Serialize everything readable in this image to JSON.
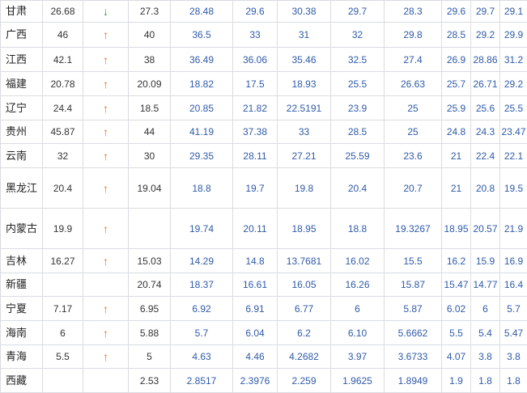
{
  "arrow_symbols": {
    "up": "↑",
    "down": "↓"
  },
  "colors": {
    "up": "#ff6a14",
    "down": "#2aa12a",
    "value": "#2f5aa8",
    "border": "#d9dce3"
  },
  "rows": [
    {
      "province": "甘肃",
      "current": "26.68",
      "trend": "down",
      "prev": "27.3",
      "values": [
        "28.48",
        "29.6",
        "30.38",
        "29.7",
        "28.3",
        "29.6",
        "29.7",
        "29.1"
      ]
    },
    {
      "province": "广西",
      "current": "46",
      "trend": "up",
      "prev": "40",
      "values": [
        "36.5",
        "33",
        "31",
        "32",
        "29.8",
        "28.5",
        "29.2",
        "29.9"
      ]
    },
    {
      "province": "江西",
      "current": "42.1",
      "trend": "up",
      "prev": "38",
      "values": [
        "36.49",
        "36.06",
        "35.46",
        "32.5",
        "27.4",
        "26.9",
        "28.86",
        "31.2"
      ]
    },
    {
      "province": "福建",
      "current": "20.78",
      "trend": "up",
      "prev": "20.09",
      "values": [
        "18.82",
        "17.5",
        "18.93",
        "25.5",
        "26.63",
        "25.7",
        "26.71",
        "29.2"
      ]
    },
    {
      "province": "辽宁",
      "current": "24.4",
      "trend": "up",
      "prev": "18.5",
      "values": [
        "20.85",
        "21.82",
        "22.5191",
        "23.9",
        "25",
        "25.9",
        "25.6",
        "25.5"
      ]
    },
    {
      "province": "贵州",
      "current": "45.87",
      "trend": "up",
      "prev": "44",
      "values": [
        "41.19",
        "37.38",
        "33",
        "28.5",
        "25",
        "24.8",
        "24.3",
        "23.47"
      ]
    },
    {
      "province": "云南",
      "current": "32",
      "trend": "up",
      "prev": "30",
      "values": [
        "29.35",
        "28.11",
        "27.21",
        "25.59",
        "23.6",
        "21",
        "22.4",
        "22.1"
      ]
    },
    {
      "province": "黑龙江",
      "current": "20.4",
      "trend": "up",
      "prev": "19.04",
      "values": [
        "18.8",
        "19.7",
        "19.8",
        "20.4",
        "20.7",
        "21",
        "20.8",
        "19.5"
      ]
    },
    {
      "province": "内蒙古",
      "current": "19.9",
      "trend": "up",
      "prev": "",
      "values": [
        "19.74",
        "20.11",
        "18.95",
        "18.8",
        "19.3267",
        "18.95",
        "20.57",
        "21.9"
      ]
    },
    {
      "province": "吉林",
      "current": "16.27",
      "trend": "up",
      "prev": "15.03",
      "values": [
        "14.29",
        "14.8",
        "13.7681",
        "16.02",
        "15.5",
        "16.2",
        "15.9",
        "16.9"
      ]
    },
    {
      "province": "新疆",
      "current": "",
      "trend": "",
      "prev": "20.74",
      "values": [
        "18.37",
        "16.61",
        "16.05",
        "16.26",
        "15.87",
        "15.47",
        "14.77",
        "16.4"
      ]
    },
    {
      "province": "宁夏",
      "current": "7.17",
      "trend": "up",
      "prev": "6.95",
      "values": [
        "6.92",
        "6.91",
        "6.77",
        "6",
        "5.87",
        "6.02",
        "6",
        "5.7"
      ]
    },
    {
      "province": "海南",
      "current": "6",
      "trend": "up",
      "prev": "5.88",
      "values": [
        "5.7",
        "6.04",
        "6.2",
        "6.10",
        "5.6662",
        "5.5",
        "5.4",
        "5.47"
      ]
    },
    {
      "province": "青海",
      "current": "5.5",
      "trend": "up",
      "prev": "5",
      "values": [
        "4.63",
        "4.46",
        "4.2682",
        "3.97",
        "3.6733",
        "4.07",
        "3.8",
        "3.8"
      ]
    },
    {
      "province": "西藏",
      "current": "",
      "trend": "",
      "prev": "2.53",
      "values": [
        "2.8517",
        "2.3976",
        "2.259",
        "1.9625",
        "1.8949",
        "1.9",
        "1.8",
        "1.8"
      ]
    }
  ]
}
